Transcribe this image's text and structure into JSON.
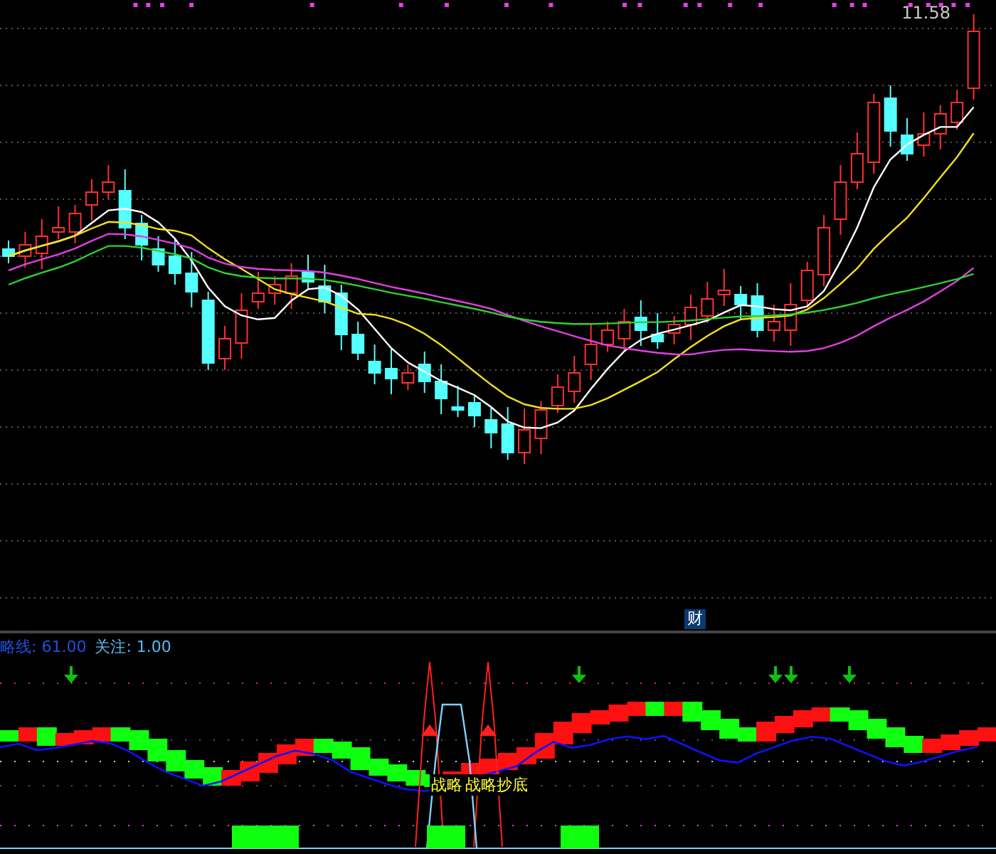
{
  "price_chart": {
    "last_price_label": "11.58",
    "info_marker": "财"
  },
  "indicator": {
    "header": [
      {
        "label": "略线:",
        "value": "61.00",
        "color": "#1f4fe0"
      },
      {
        "label": "关注:",
        "value": "1.00",
        "color": "#5ab8f0"
      }
    ],
    "signal_labels": [
      "战略",
      "战略抄底"
    ]
  }
}
